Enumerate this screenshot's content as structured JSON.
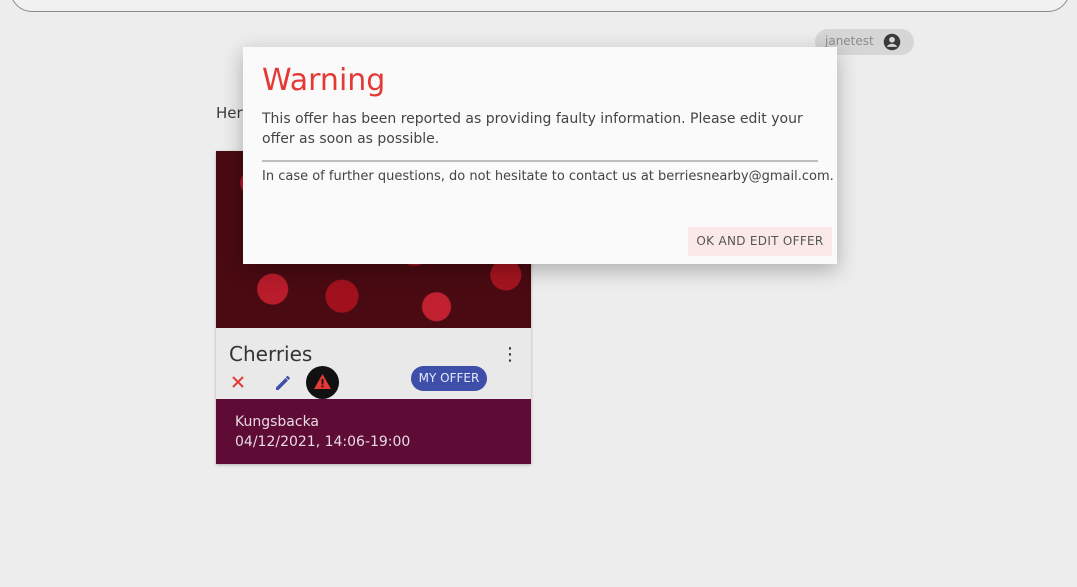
{
  "header": {
    "username": "janetest",
    "avatar_icon": "account-circle-icon"
  },
  "main": {
    "intro_text": "Here"
  },
  "offer_card": {
    "title": "Cherries",
    "image_alt": "cherries photo",
    "menu_icon": "more-vert-icon",
    "actions": {
      "delete_icon": "close-icon",
      "edit_icon": "pencil-icon",
      "warning_icon": "warning-icon"
    },
    "badge": "MY OFFER",
    "location": "Kungsbacka",
    "datetime": "04/12/2021, 14:06-19:00",
    "footer_color": "#5e0b35"
  },
  "dialog": {
    "title": "Warning",
    "message": "This offer has been reported as providing faulty information. Please edit your offer as soon as possible.",
    "contact": "In case of further questions, do not hesitate to contact us at berriesnearby@gmail.com.",
    "button_label": "OK AND EDIT OFFER",
    "title_color": "#e53935"
  }
}
